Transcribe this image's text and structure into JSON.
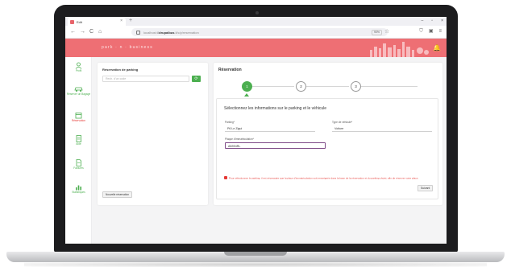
{
  "browser": {
    "tab_title": "Edit",
    "tab_close": "×",
    "new_tab": "+",
    "window_controls": [
      "–",
      "▫",
      "×"
    ],
    "nav": {
      "back": "←",
      "forward": "→",
      "reload": "C",
      "home": "⌂"
    },
    "url_prefix": "localhost:8",
    "url_domain": "drupalbus",
    "url_suffix": ".lt/c/y/reservation",
    "zoom": "90%",
    "star": "☆"
  },
  "app": {
    "brand": "park · n · business",
    "accent": "#ee6f74",
    "green": "#4caf50"
  },
  "sidebar": {
    "items": [
      {
        "label": "Profil",
        "icon": "user-icon"
      },
      {
        "label": "Réserver un Bagage",
        "icon": "car-icon"
      },
      {
        "label": "Réservation",
        "icon": "calendar-icon"
      },
      {
        "label": "Aide",
        "icon": "document-icon"
      },
      {
        "label": "Factures",
        "icon": "invoice-icon"
      },
      {
        "label": "Statistiques",
        "icon": "chart-icon"
      }
    ]
  },
  "left_panel": {
    "title": "Réservation de parking",
    "search_placeholder": "Rech. d'un code",
    "search_button": "⟳",
    "new_button": "Nouvelle réservation"
  },
  "main": {
    "title": "Réservation",
    "steps": [
      "1",
      "2",
      "3"
    ],
    "form": {
      "title": "Sélectionnez les informations sur le parking et le véhicule",
      "parking_label": "Parking*",
      "parking_value": "P6 Le Zigui",
      "vehicle_type_label": "Type de véhicule*",
      "vehicle_type_value": "Voiture",
      "plate_label": "Plaque d'immatriculation*",
      "plate_value": "AB994RL",
      "warning": "Pour sélectionner le parking, il est nécessaire que la place d'immatriculation soit renseignée dans la base de la réservation et du parking choisi, afin de réserver votre place.",
      "submit": "Suivant"
    }
  }
}
